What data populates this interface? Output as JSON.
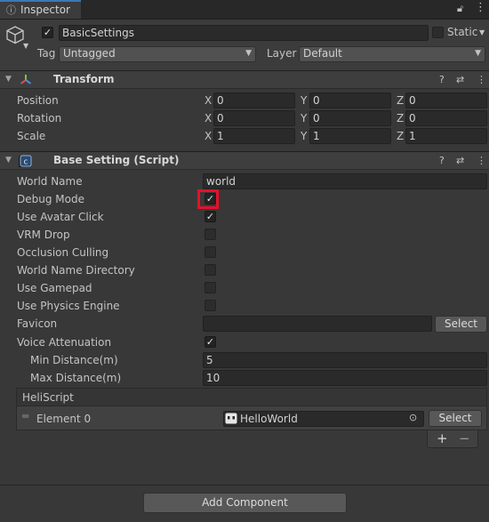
{
  "tab": {
    "label": "Inspector"
  },
  "object": {
    "name": "BasicSettings",
    "static_label": "Static",
    "tag_label": "Tag",
    "tag_value": "Untagged",
    "layer_label": "Layer",
    "layer_value": "Default"
  },
  "transform": {
    "title": "Transform",
    "rows": [
      {
        "label": "Position",
        "x": "0",
        "y": "0",
        "z": "0"
      },
      {
        "label": "Rotation",
        "x": "0",
        "y": "0",
        "z": "0"
      },
      {
        "label": "Scale",
        "x": "1",
        "y": "1",
        "z": "1"
      }
    ],
    "axis_x": "X",
    "axis_y": "Y",
    "axis_z": "Z"
  },
  "script": {
    "title": "Base Setting (Script)",
    "world_name_label": "World Name",
    "world_name_value": "world",
    "debug_mode": "Debug Mode",
    "use_avatar_click": "Use Avatar Click",
    "vrm_drop": "VRM Drop",
    "occlusion_culling": "Occlusion Culling",
    "world_name_directory": "World Name Directory",
    "use_gamepad": "Use Gamepad",
    "use_physics_engine": "Use Physics Engine",
    "favicon_label": "Favicon",
    "favicon_value": "",
    "select_label": "Select",
    "voice_attenuation": "Voice Attenuation",
    "min_distance_label": "Min Distance(m)",
    "min_distance_value": "5",
    "max_distance_label": "Max Distance(m)",
    "max_distance_value": "10",
    "heliscript_label": "HeliScript",
    "element0_label": "Element 0",
    "element0_value": "HelloWorld",
    "element_select_label": "Select",
    "plus": "+",
    "minus": "−"
  },
  "checks": {
    "debug_mode": true,
    "use_avatar_click": true,
    "voice_attenuation": true
  },
  "footer": {
    "add_component": "Add Component"
  },
  "colors": {
    "highlight": "#e8102a",
    "accent": "#3a79bb"
  }
}
